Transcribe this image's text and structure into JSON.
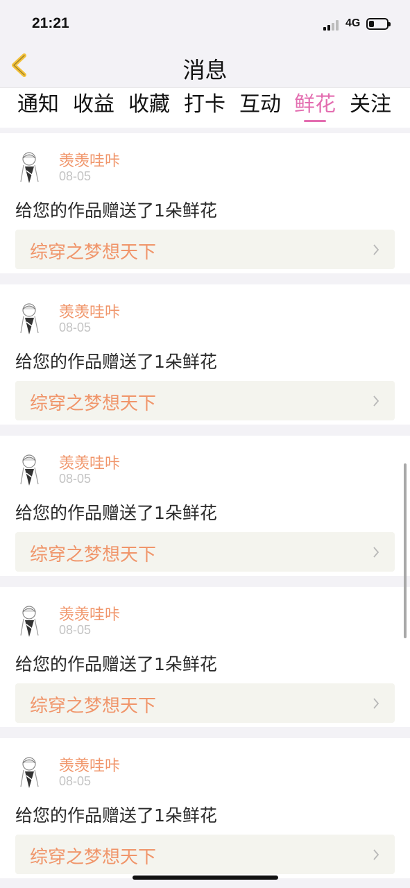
{
  "status_bar": {
    "time": "21:21",
    "network": "4G"
  },
  "header": {
    "title": "消息"
  },
  "tabs": [
    {
      "label": "通知"
    },
    {
      "label": "收益"
    },
    {
      "label": "收藏"
    },
    {
      "label": "打卡"
    },
    {
      "label": "互动"
    },
    {
      "label": "鲜花",
      "active": true
    },
    {
      "label": "关注"
    }
  ],
  "messages": [
    {
      "username": "羡羡哇咔",
      "date": "08-05",
      "text": "给您的作品赠送了1朵鲜花",
      "work_title": "综穿之梦想天下"
    },
    {
      "username": "羡羡哇咔",
      "date": "08-05",
      "text": "给您的作品赠送了1朵鲜花",
      "work_title": "综穿之梦想天下"
    },
    {
      "username": "羡羡哇咔",
      "date": "08-05",
      "text": "给您的作品赠送了1朵鲜花",
      "work_title": "综穿之梦想天下"
    },
    {
      "username": "羡羡哇咔",
      "date": "08-05",
      "text": "给您的作品赠送了1朵鲜花",
      "work_title": "综穿之梦想天下"
    },
    {
      "username": "羡羡哇咔",
      "date": "08-05",
      "text": "给您的作品赠送了1朵鲜花",
      "work_title": "综穿之梦想天下"
    }
  ],
  "colors": {
    "accent": "#e36db0",
    "username": "#f0956a",
    "background": "#f3f2f6"
  }
}
